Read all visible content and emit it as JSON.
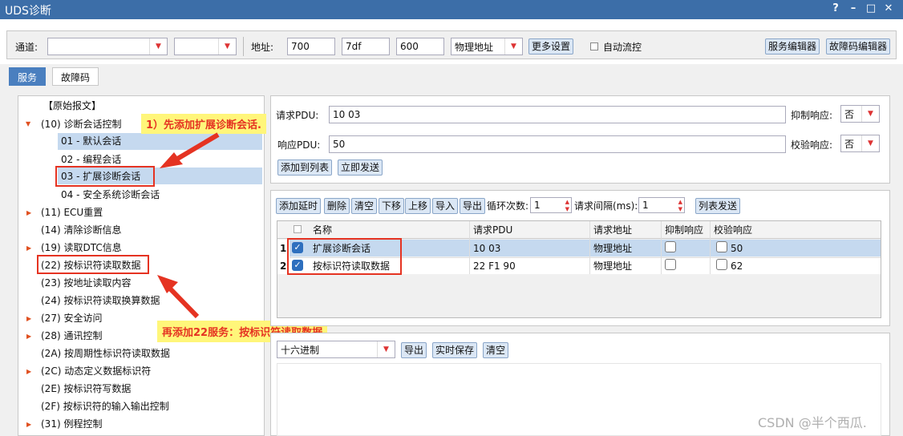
{
  "window": {
    "title": "UDS诊断",
    "help": "?",
    "minimize": "–",
    "maximize": "□",
    "close": "✕"
  },
  "toolbar": {
    "channel_label": "通道:",
    "channel_value": "",
    "channel2_value": "",
    "address_label": "地址:",
    "addr1": "700",
    "addr2": "7df",
    "addr3": "600",
    "addr_type": "物理地址",
    "more_settings": "更多设置",
    "auto_flow_label": "自动流控",
    "service_editor": "服务编辑器",
    "dtc_editor": "故障码编辑器"
  },
  "tabs": [
    {
      "label": "服务"
    },
    {
      "label": "故障码"
    }
  ],
  "tree": {
    "items": [
      {
        "label": "【原始报文】"
      },
      {
        "label": "(10) 诊断会话控制"
      },
      {
        "label": "01 - 默认会话"
      },
      {
        "label": "02 - 编程会话"
      },
      {
        "label": "03 - 扩展诊断会话"
      },
      {
        "label": "04 - 安全系统诊断会话"
      },
      {
        "label": "(11) ECU重置"
      },
      {
        "label": "(14) 清除诊断信息"
      },
      {
        "label": "(19) 读取DTC信息"
      },
      {
        "label": "(22) 按标识符读取数据"
      },
      {
        "label": "(23) 按地址读取内容"
      },
      {
        "label": "(24) 按标识符读取换算数据"
      },
      {
        "label": "(27) 安全访问"
      },
      {
        "label": "(28) 通讯控制"
      },
      {
        "label": "(2A) 按周期性标识符读取数据"
      },
      {
        "label": "(2C) 动态定义数据标识符"
      },
      {
        "label": "(2E) 按标识符写数据"
      },
      {
        "label": "(2F) 按标识符的输入输出控制"
      },
      {
        "label": "(31) 例程控制"
      }
    ]
  },
  "annotations": {
    "callout1": "1）先添加扩展诊断会话.",
    "callout2": "再添加22服务：按标识符读取数据"
  },
  "request": {
    "req_label": "请求PDU:",
    "req_value": "10 03",
    "suppress_label": "抑制响应:",
    "suppress_value": "否",
    "resp_label": "响应PDU:",
    "resp_value": "50",
    "verify_label": "校验响应:",
    "verify_value": "否",
    "add_to_list": "添加到列表",
    "send_now": "立即发送"
  },
  "list_toolbar": {
    "add_delay": "添加延时",
    "delete": "删除",
    "clear": "清空",
    "move_down": "下移",
    "move_up": "上移",
    "import": "导入",
    "export": "导出",
    "loop_label": "循环次数:",
    "loop_value": "1",
    "interval_label": "请求间隔(ms):",
    "interval_value": "1",
    "list_send": "列表发送"
  },
  "grid": {
    "headers": {
      "name": "名称",
      "req_pdu": "请求PDU",
      "req_addr": "请求地址",
      "suppress": "抑制响应",
      "verify": "校验响应"
    },
    "rows": [
      {
        "index": "1",
        "name": "扩展诊断会话",
        "pdu": "10 03",
        "addr": "物理地址",
        "verify": "50"
      },
      {
        "index": "2",
        "name": "按标识符读取数据",
        "pdu": "22 F1 90",
        "addr": "物理地址",
        "verify": "62"
      }
    ]
  },
  "log": {
    "format": "十六进制",
    "export": "导出",
    "realtime_save": "实时保存",
    "clear": "清空"
  },
  "watermark": "CSDN @半个西瓜.",
  "colors": {
    "titlebar": "#3c6ea8",
    "accent": "#4a7fbf",
    "annotation_red": "#e53322",
    "callout_bg": "#fff67a"
  }
}
